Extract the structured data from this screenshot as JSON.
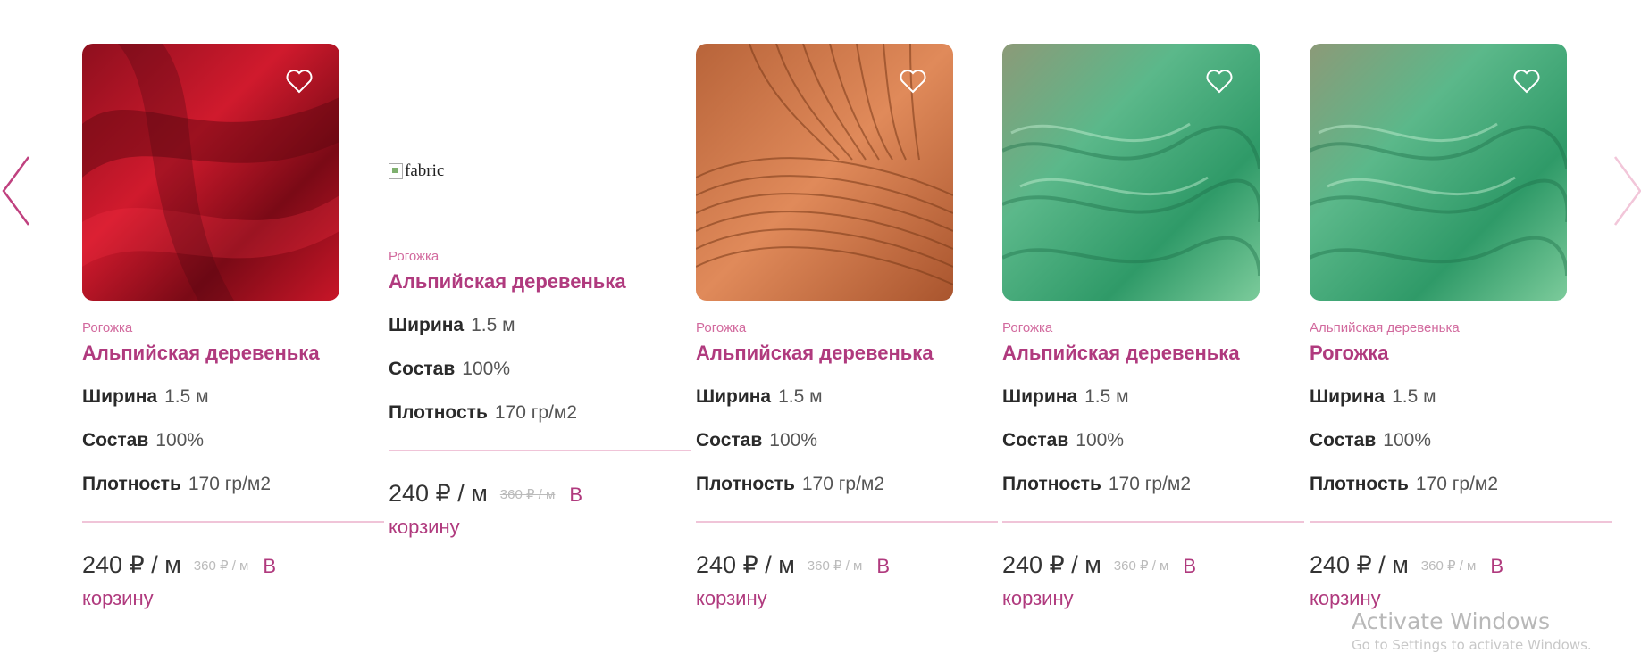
{
  "colors": {
    "accent": "#b03a7e",
    "category": "#d26a9e",
    "divider": "#f0c4d8"
  },
  "nav": {
    "prev_icon": "chevron-left-icon",
    "next_icon": "chevron-right-icon"
  },
  "products": [
    {
      "image": "red-fabric",
      "category": "Рогожка",
      "title": "Альпийская деревенька",
      "props": [
        {
          "label": "Ширина",
          "value": "1.5 м"
        },
        {
          "label": "Состав",
          "value": "100%"
        },
        {
          "label": "Плотность",
          "value": "170 гр/м2"
        }
      ],
      "price": "240 ₽ / м",
      "old_price": "360 ₽ / м",
      "cart_label": "В корзину"
    },
    {
      "image": "broken",
      "image_alt": "fabric",
      "category": "Рогожка",
      "title": "Альпийская деревенька",
      "props": [
        {
          "label": "Ширина",
          "value": "1.5 м"
        },
        {
          "label": "Состав",
          "value": "100%"
        },
        {
          "label": "Плотность",
          "value": "170 гр/м2"
        }
      ],
      "price": "240 ₽ / м",
      "old_price": "360 ₽ / м",
      "cart_label": "В корзину"
    },
    {
      "image": "orange-fabric",
      "category": "Рогожка",
      "title": "Альпийская деревенька",
      "props": [
        {
          "label": "Ширина",
          "value": "1.5 м"
        },
        {
          "label": "Состав",
          "value": "100%"
        },
        {
          "label": "Плотность",
          "value": "170 гр/м2"
        }
      ],
      "price": "240 ₽ / м",
      "old_price": "360 ₽ / м",
      "cart_label": "В корзину"
    },
    {
      "image": "green-fabric",
      "category": "Рогожка",
      "title": "Альпийская деревенька",
      "props": [
        {
          "label": "Ширина",
          "value": "1.5 м"
        },
        {
          "label": "Состав",
          "value": "100%"
        },
        {
          "label": "Плотность",
          "value": "170 гр/м2"
        }
      ],
      "price": "240 ₽ / м",
      "old_price": "360 ₽ / м",
      "cart_label": "В корзину"
    },
    {
      "image": "green-fabric",
      "category": "Альпийская деревенька",
      "title": "Рогожка",
      "props": [
        {
          "label": "Ширина",
          "value": "1.5 м"
        },
        {
          "label": "Состав",
          "value": "100%"
        },
        {
          "label": "Плотность",
          "value": "170 гр/м2"
        }
      ],
      "price": "240 ₽ / м",
      "old_price": "360 ₽ / м",
      "cart_label": "В корзину"
    }
  ],
  "watermark": {
    "title": "Activate Windows",
    "subtitle": "Go to Settings to activate Windows."
  }
}
